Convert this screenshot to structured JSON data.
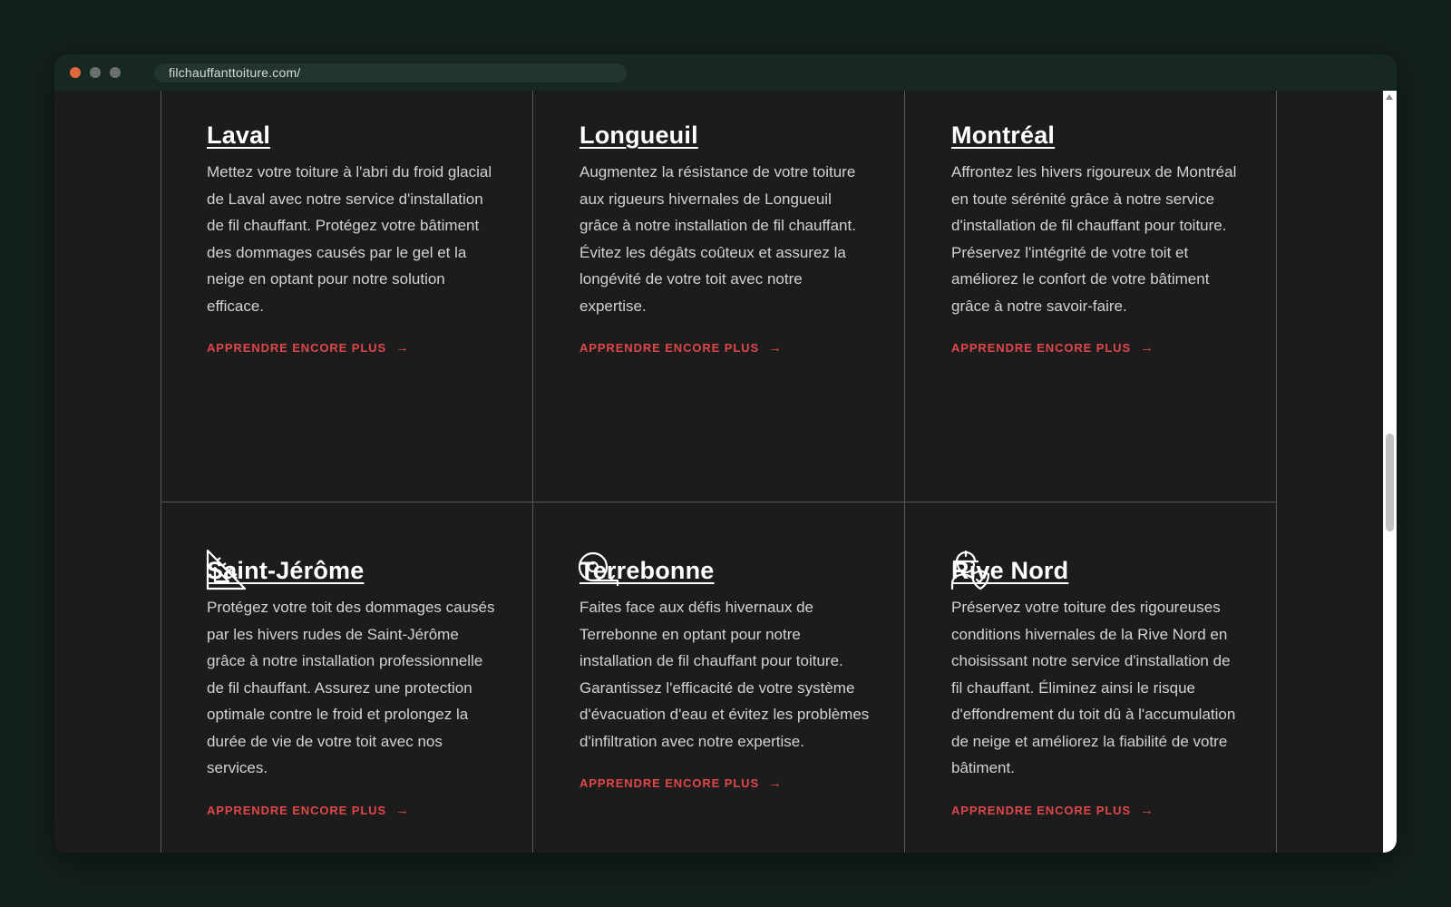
{
  "browser": {
    "url": "filchauffanttoiture.com/"
  },
  "cities": [
    {
      "name": "Laval",
      "description": "Mettez votre toiture à l'abri du froid glacial de Laval avec notre service d'installation de fil chauffant. Protégez votre bâtiment des dommages causés par le gel et la neige en optant pour notre solution efficace.",
      "link_label": "APPRENDRE ENCORE PLUS",
      "arrow": "→"
    },
    {
      "name": "Longueuil",
      "description": "Augmentez la résistance de votre toiture aux rigueurs hivernales de Longueuil grâce à notre installation de fil chauffant. Évitez les dégâts coûteux et assurez la longévité de votre toit avec notre expertise.",
      "link_label": "APPRENDRE ENCORE PLUS",
      "arrow": "→"
    },
    {
      "name": "Montréal",
      "description": "Affrontez les hivers rigoureux de Montréal en toute sérénité grâce à notre service d'installation de fil chauffant pour toiture. Préservez l'intégrité de votre toit et améliorez le confort de votre bâtiment grâce à notre savoir-faire.",
      "link_label": "APPRENDRE ENCORE PLUS",
      "arrow": "→"
    },
    {
      "name": "Saint-Jérôme",
      "icon": "set-square-ruler-icon",
      "description": "Protégez votre toit des dommages causés par les hivers rudes de Saint-Jérôme grâce à notre installation professionnelle de fil chauffant. Assurez une protection optimale contre le froid et prolongez la durée de vie de votre toit avec nos services.",
      "link_label": "APPRENDRE ENCORE PLUS",
      "arrow": "→"
    },
    {
      "name": "Terrebonne",
      "icon": "measuring-tape-icon",
      "description": "Faites face aux défis hivernaux de Terrebonne en optant pour notre installation de fil chauffant pour toiture. Garantissez l'efficacité de votre système d'évacuation d'eau et évitez les problèmes d'infiltration avec notre expertise.",
      "link_label": "APPRENDRE ENCORE PLUS",
      "arrow": "→"
    },
    {
      "name": "Rive Nord",
      "icon": "worker-shield-icon",
      "description": "Préservez votre toiture des rigoureuses conditions hivernales de la Rive Nord en choisissant notre service d'installation de fil chauffant. Éliminez ainsi le risque d'effondrement du toit dû à l'accumulation de neige et améliorez la fiabilité de votre bâtiment.",
      "link_label": "APPRENDRE ENCORE PLUS",
      "arrow": "→"
    }
  ],
  "colors": {
    "background": "#14201d",
    "page": "#1c1c1c",
    "accent": "#e0474a",
    "text": "#d2d2d2"
  }
}
